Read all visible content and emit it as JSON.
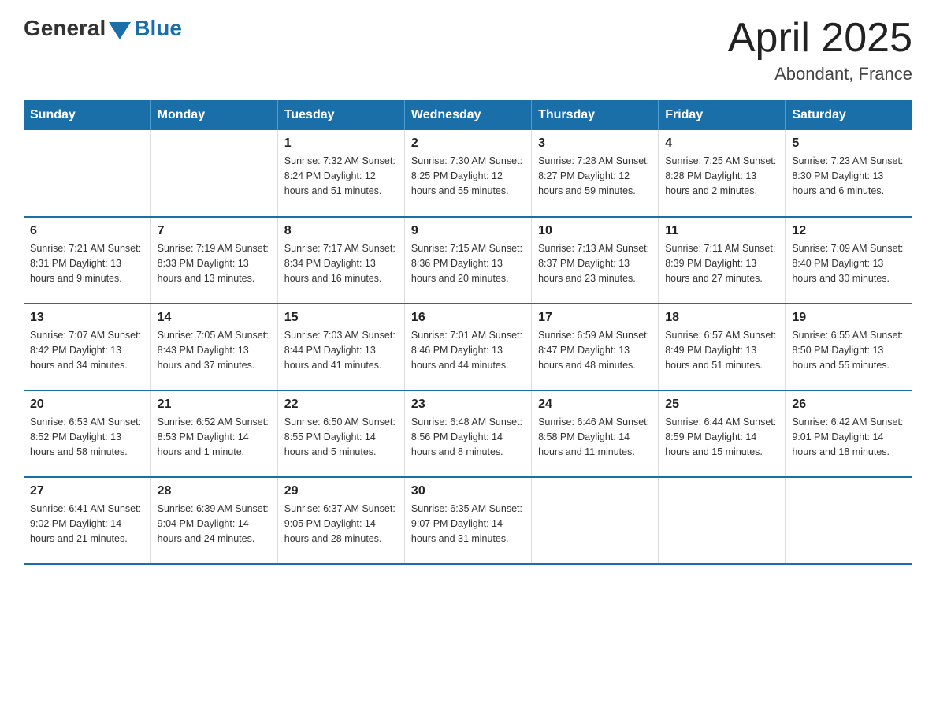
{
  "logo": {
    "general": "General",
    "blue": "Blue"
  },
  "title": "April 2025",
  "location": "Abondant, France",
  "days_of_week": [
    "Sunday",
    "Monday",
    "Tuesday",
    "Wednesday",
    "Thursday",
    "Friday",
    "Saturday"
  ],
  "weeks": [
    [
      {
        "day": "",
        "info": ""
      },
      {
        "day": "",
        "info": ""
      },
      {
        "day": "1",
        "info": "Sunrise: 7:32 AM\nSunset: 8:24 PM\nDaylight: 12 hours\nand 51 minutes."
      },
      {
        "day": "2",
        "info": "Sunrise: 7:30 AM\nSunset: 8:25 PM\nDaylight: 12 hours\nand 55 minutes."
      },
      {
        "day": "3",
        "info": "Sunrise: 7:28 AM\nSunset: 8:27 PM\nDaylight: 12 hours\nand 59 minutes."
      },
      {
        "day": "4",
        "info": "Sunrise: 7:25 AM\nSunset: 8:28 PM\nDaylight: 13 hours\nand 2 minutes."
      },
      {
        "day": "5",
        "info": "Sunrise: 7:23 AM\nSunset: 8:30 PM\nDaylight: 13 hours\nand 6 minutes."
      }
    ],
    [
      {
        "day": "6",
        "info": "Sunrise: 7:21 AM\nSunset: 8:31 PM\nDaylight: 13 hours\nand 9 minutes."
      },
      {
        "day": "7",
        "info": "Sunrise: 7:19 AM\nSunset: 8:33 PM\nDaylight: 13 hours\nand 13 minutes."
      },
      {
        "day": "8",
        "info": "Sunrise: 7:17 AM\nSunset: 8:34 PM\nDaylight: 13 hours\nand 16 minutes."
      },
      {
        "day": "9",
        "info": "Sunrise: 7:15 AM\nSunset: 8:36 PM\nDaylight: 13 hours\nand 20 minutes."
      },
      {
        "day": "10",
        "info": "Sunrise: 7:13 AM\nSunset: 8:37 PM\nDaylight: 13 hours\nand 23 minutes."
      },
      {
        "day": "11",
        "info": "Sunrise: 7:11 AM\nSunset: 8:39 PM\nDaylight: 13 hours\nand 27 minutes."
      },
      {
        "day": "12",
        "info": "Sunrise: 7:09 AM\nSunset: 8:40 PM\nDaylight: 13 hours\nand 30 minutes."
      }
    ],
    [
      {
        "day": "13",
        "info": "Sunrise: 7:07 AM\nSunset: 8:42 PM\nDaylight: 13 hours\nand 34 minutes."
      },
      {
        "day": "14",
        "info": "Sunrise: 7:05 AM\nSunset: 8:43 PM\nDaylight: 13 hours\nand 37 minutes."
      },
      {
        "day": "15",
        "info": "Sunrise: 7:03 AM\nSunset: 8:44 PM\nDaylight: 13 hours\nand 41 minutes."
      },
      {
        "day": "16",
        "info": "Sunrise: 7:01 AM\nSunset: 8:46 PM\nDaylight: 13 hours\nand 44 minutes."
      },
      {
        "day": "17",
        "info": "Sunrise: 6:59 AM\nSunset: 8:47 PM\nDaylight: 13 hours\nand 48 minutes."
      },
      {
        "day": "18",
        "info": "Sunrise: 6:57 AM\nSunset: 8:49 PM\nDaylight: 13 hours\nand 51 minutes."
      },
      {
        "day": "19",
        "info": "Sunrise: 6:55 AM\nSunset: 8:50 PM\nDaylight: 13 hours\nand 55 minutes."
      }
    ],
    [
      {
        "day": "20",
        "info": "Sunrise: 6:53 AM\nSunset: 8:52 PM\nDaylight: 13 hours\nand 58 minutes."
      },
      {
        "day": "21",
        "info": "Sunrise: 6:52 AM\nSunset: 8:53 PM\nDaylight: 14 hours\nand 1 minute."
      },
      {
        "day": "22",
        "info": "Sunrise: 6:50 AM\nSunset: 8:55 PM\nDaylight: 14 hours\nand 5 minutes."
      },
      {
        "day": "23",
        "info": "Sunrise: 6:48 AM\nSunset: 8:56 PM\nDaylight: 14 hours\nand 8 minutes."
      },
      {
        "day": "24",
        "info": "Sunrise: 6:46 AM\nSunset: 8:58 PM\nDaylight: 14 hours\nand 11 minutes."
      },
      {
        "day": "25",
        "info": "Sunrise: 6:44 AM\nSunset: 8:59 PM\nDaylight: 14 hours\nand 15 minutes."
      },
      {
        "day": "26",
        "info": "Sunrise: 6:42 AM\nSunset: 9:01 PM\nDaylight: 14 hours\nand 18 minutes."
      }
    ],
    [
      {
        "day": "27",
        "info": "Sunrise: 6:41 AM\nSunset: 9:02 PM\nDaylight: 14 hours\nand 21 minutes."
      },
      {
        "day": "28",
        "info": "Sunrise: 6:39 AM\nSunset: 9:04 PM\nDaylight: 14 hours\nand 24 minutes."
      },
      {
        "day": "29",
        "info": "Sunrise: 6:37 AM\nSunset: 9:05 PM\nDaylight: 14 hours\nand 28 minutes."
      },
      {
        "day": "30",
        "info": "Sunrise: 6:35 AM\nSunset: 9:07 PM\nDaylight: 14 hours\nand 31 minutes."
      },
      {
        "day": "",
        "info": ""
      },
      {
        "day": "",
        "info": ""
      },
      {
        "day": "",
        "info": ""
      }
    ]
  ]
}
